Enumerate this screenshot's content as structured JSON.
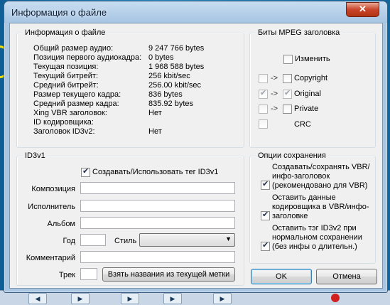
{
  "window": {
    "title": "Информация о файле",
    "close_glyph": "✕"
  },
  "file_info": {
    "legend": "Информация о файле",
    "rows": [
      {
        "label": "Общий размер аудио:",
        "value": "9 247 766 bytes"
      },
      {
        "label": "Позиция первого аудиокадра:",
        "value": "0 bytes"
      },
      {
        "label": "Текущая позиция:",
        "value": "1 968 588 bytes"
      },
      {
        "label": "Текущий битрейт:",
        "value": "256 kbit/sec"
      },
      {
        "label": "Средний битрейт:",
        "value": "256.00 kbit/sec"
      },
      {
        "label": "Размер текущего кадра:",
        "value": "836 bytes"
      },
      {
        "label": "Средний размер кадра:",
        "value": "835.92 bytes"
      },
      {
        "label": "Xing VBR заголовок:",
        "value": "Нет"
      },
      {
        "label": "ID кодировщика:",
        "value": ""
      },
      {
        "label": "Заголовок ID3v2:",
        "value": "Нет"
      }
    ]
  },
  "mpeg_bits": {
    "legend": "Биты MPEG заголовка",
    "change_label": "Изменить",
    "arrow": "->",
    "copyright_label": "Copyright",
    "original_label": "Original",
    "private_label": "Private",
    "crc_label": "CRC"
  },
  "id3v1": {
    "legend": "ID3v1",
    "create_label": "Создавать/Использовать тег ID3v1",
    "composition_label": "Композиция",
    "artist_label": "Исполнитель",
    "album_label": "Альбом",
    "year_label": "Год",
    "style_label": "Стиль",
    "comment_label": "Комментарий",
    "track_label": "Трек",
    "fetch_button": "Взять названия из текущей метки",
    "composition_value": "",
    "artist_value": "",
    "album_value": "",
    "year_value": "",
    "style_value": "",
    "comment_value": "",
    "track_value": ""
  },
  "save_options": {
    "legend": "Опции сохранения",
    "opt1": "Создавать/сохранять VBR/инфо-заголовок (рекомендовано для VBR)",
    "opt2": "Оставить данные кодировщика в VBR/инфо-заголовке",
    "opt3": "Оставить тэг ID3v2 при нормальном сохранении (без инфы о длительн.)"
  },
  "buttons": {
    "ok": "OK",
    "cancel": "Отмена"
  },
  "colors": {
    "accent": "#3c7fb1",
    "close": "#c8452b",
    "record": "#c81b1b"
  }
}
